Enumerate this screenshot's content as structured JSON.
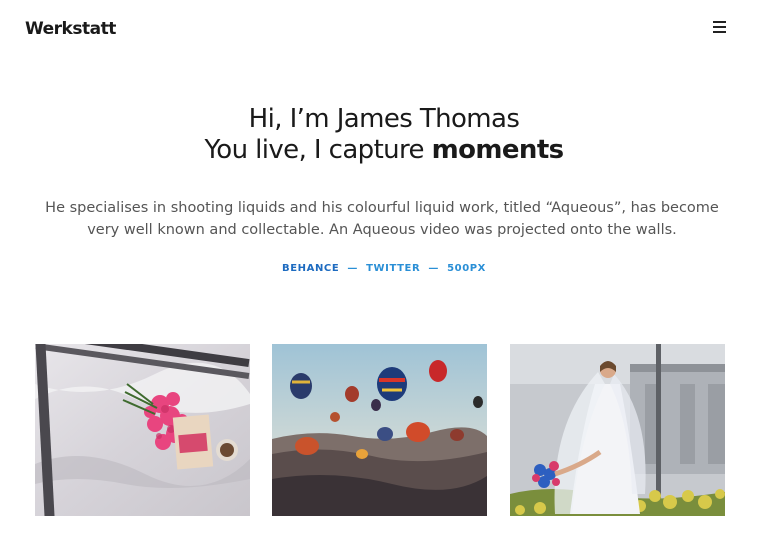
{
  "brand": {
    "name": "Werkstatt"
  },
  "header": {
    "menu_icon": "hamburger-menu-icon"
  },
  "hero": {
    "line1": "Hi, I’m James Thomas",
    "line2_prefix": "You live, I capture ",
    "line2_bold": "moments",
    "description": "He specialises in shooting liquids and his colourful liquid work, titled “Aqueous”, has become very well known and collectable. An Aqueous video was projected onto the walls."
  },
  "social": {
    "links": [
      "BEHANCE",
      "TWITTER",
      "500PX"
    ],
    "separator": "—"
  },
  "gallery": [
    {
      "subject": "flowers-book-coffee-on-bed"
    },
    {
      "subject": "hot-air-balloons-over-valley"
    },
    {
      "subject": "bride-with-bouquet"
    }
  ],
  "colors": {
    "link": "#2a8fd6",
    "link_dark": "#1d6bc0",
    "text": "#555555"
  }
}
